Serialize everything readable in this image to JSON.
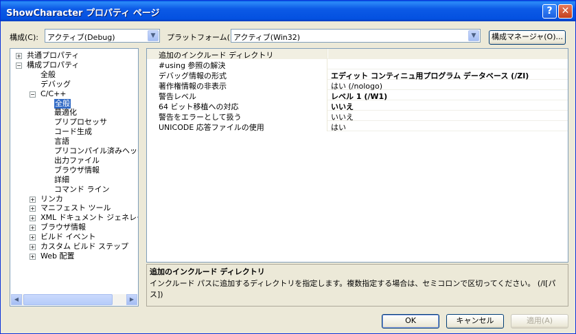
{
  "window": {
    "title": "ShowCharacter プロパティ ページ",
    "help_label": "?",
    "close_label": "✕"
  },
  "config": {
    "label": "構成(C):",
    "value": "アクティブ(Debug)"
  },
  "platform": {
    "label": "プラットフォーム(P):",
    "value": "アクティブ(Win32)"
  },
  "config_manager_label": "構成マネージャ(O)...",
  "tree": {
    "items": [
      {
        "label": "共通プロパティ",
        "expander": "+"
      },
      {
        "label": "構成プロパティ",
        "expander": "−"
      },
      {
        "label": "全般"
      },
      {
        "label": "デバッグ"
      },
      {
        "label": "C/C++",
        "expander": "−"
      },
      {
        "label": "全般",
        "selected": true
      },
      {
        "label": "最適化"
      },
      {
        "label": "プリプロセッサ"
      },
      {
        "label": "コード生成"
      },
      {
        "label": "言語"
      },
      {
        "label": "プリコンパイル済みヘッダー"
      },
      {
        "label": "出力ファイル"
      },
      {
        "label": "ブラウザ情報"
      },
      {
        "label": "詳細"
      },
      {
        "label": "コマンド ライン"
      },
      {
        "label": "リンカ",
        "expander": "+"
      },
      {
        "label": "マニフェスト ツール",
        "expander": "+"
      },
      {
        "label": "XML ドキュメント ジェネレータ",
        "expander": "+"
      },
      {
        "label": "ブラウザ情報",
        "expander": "+"
      },
      {
        "label": "ビルド イベント",
        "expander": "+"
      },
      {
        "label": "カスタム ビルド ステップ",
        "expander": "+"
      },
      {
        "label": "Web 配置",
        "expander": "+"
      }
    ]
  },
  "grid": {
    "rows": [
      {
        "name": "追加のインクルード ディレクトリ",
        "value": ""
      },
      {
        "name": "#using 参照の解決",
        "value": ""
      },
      {
        "name": "デバッグ情報の形式",
        "value": "エディット コンティニュ用プログラム データベース (/ZI)",
        "bold": true
      },
      {
        "name": "著作権情報の非表示",
        "value": "はい (/nologo)"
      },
      {
        "name": "警告レベル",
        "value": "レベル 1 (/W1)",
        "bold": true
      },
      {
        "name": "64 ビット移植への対応",
        "value": "いいえ",
        "bold": true
      },
      {
        "name": "警告をエラーとして扱う",
        "value": "いいえ"
      },
      {
        "name": "UNICODE 応答ファイルの使用",
        "value": "はい"
      }
    ]
  },
  "description": {
    "title": "追加のインクルード ディレクトリ",
    "text": "インクルード パスに追加するディレクトリを指定します。複数指定する場合は、セミコロンで区切ってください。 (/I[パス])"
  },
  "buttons": {
    "ok": "OK",
    "cancel": "キャンセル",
    "apply": "適用(A)"
  }
}
